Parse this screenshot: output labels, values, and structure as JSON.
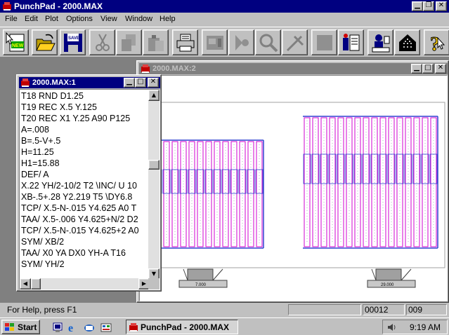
{
  "app": {
    "title": "PunchPad - 2000.MAX"
  },
  "menu": [
    "File",
    "Edit",
    "Plot",
    "Options",
    "View",
    "Window",
    "Help"
  ],
  "toolbar": {
    "buttons": [
      {
        "icon": "new-icon",
        "label": "NEW"
      },
      {
        "icon": "open-folder-icon"
      },
      {
        "icon": "save-disk-icon",
        "label": "SAVE"
      },
      {
        "icon": "scissors-icon"
      },
      {
        "icon": "copy-pages-icon"
      },
      {
        "icon": "paste-icon"
      },
      {
        "icon": "printer-icon"
      },
      {
        "icon": "punch-machine-icon"
      },
      {
        "icon": "tool-icon"
      },
      {
        "icon": "magnifier-icon"
      },
      {
        "icon": "caliper-icon"
      },
      {
        "icon": "gray-square-icon"
      },
      {
        "icon": "file-tube-icon"
      },
      {
        "icon": "operator-icon"
      },
      {
        "icon": "dotted-house-icon"
      },
      {
        "icon": "help-question-icon"
      }
    ]
  },
  "editor_window": {
    "title": "2000.MAX:1",
    "lines": [
      "T18 RND D1.25",
      "T19 REC X.5 Y.125",
      "T20 REC X1 Y.25 A90 P125",
      "A=.008",
      "B=.5-V+.5",
      "H=11.25",
      "H1=15.88",
      "DEF/ A",
      "X.22 YH/2-10/2 T2 \\INC/ U 10",
      "XB-.5+.28 Y2.219 T5 \\DY6.8",
      "TCP/ X.5-N-.015 Y4.625 A0 T",
      "TAA/ X.5-.006 Y4.625+N/2 D2",
      "TCP/ X.5-N-.015 Y4.625+2 A0",
      "SYM/ XB/2",
      "TAA/ X0 YA DX0 YH-A T16",
      "SYM/ YH/2"
    ]
  },
  "drawing_window": {
    "title": "2000.MAX:2",
    "clamp_labels": [
      "7.000",
      "29.000"
    ],
    "colors": {
      "outline": "#3040d0",
      "punch": "#d000d0",
      "fixture": "#808080"
    }
  },
  "status": {
    "help_text": "For Help, press F1",
    "field1": "",
    "field2": "00012",
    "field3": "009"
  },
  "taskbar": {
    "start_label": "Start",
    "task_label": "PunchPad - 2000.MAX",
    "clock": "9:19 AM"
  }
}
